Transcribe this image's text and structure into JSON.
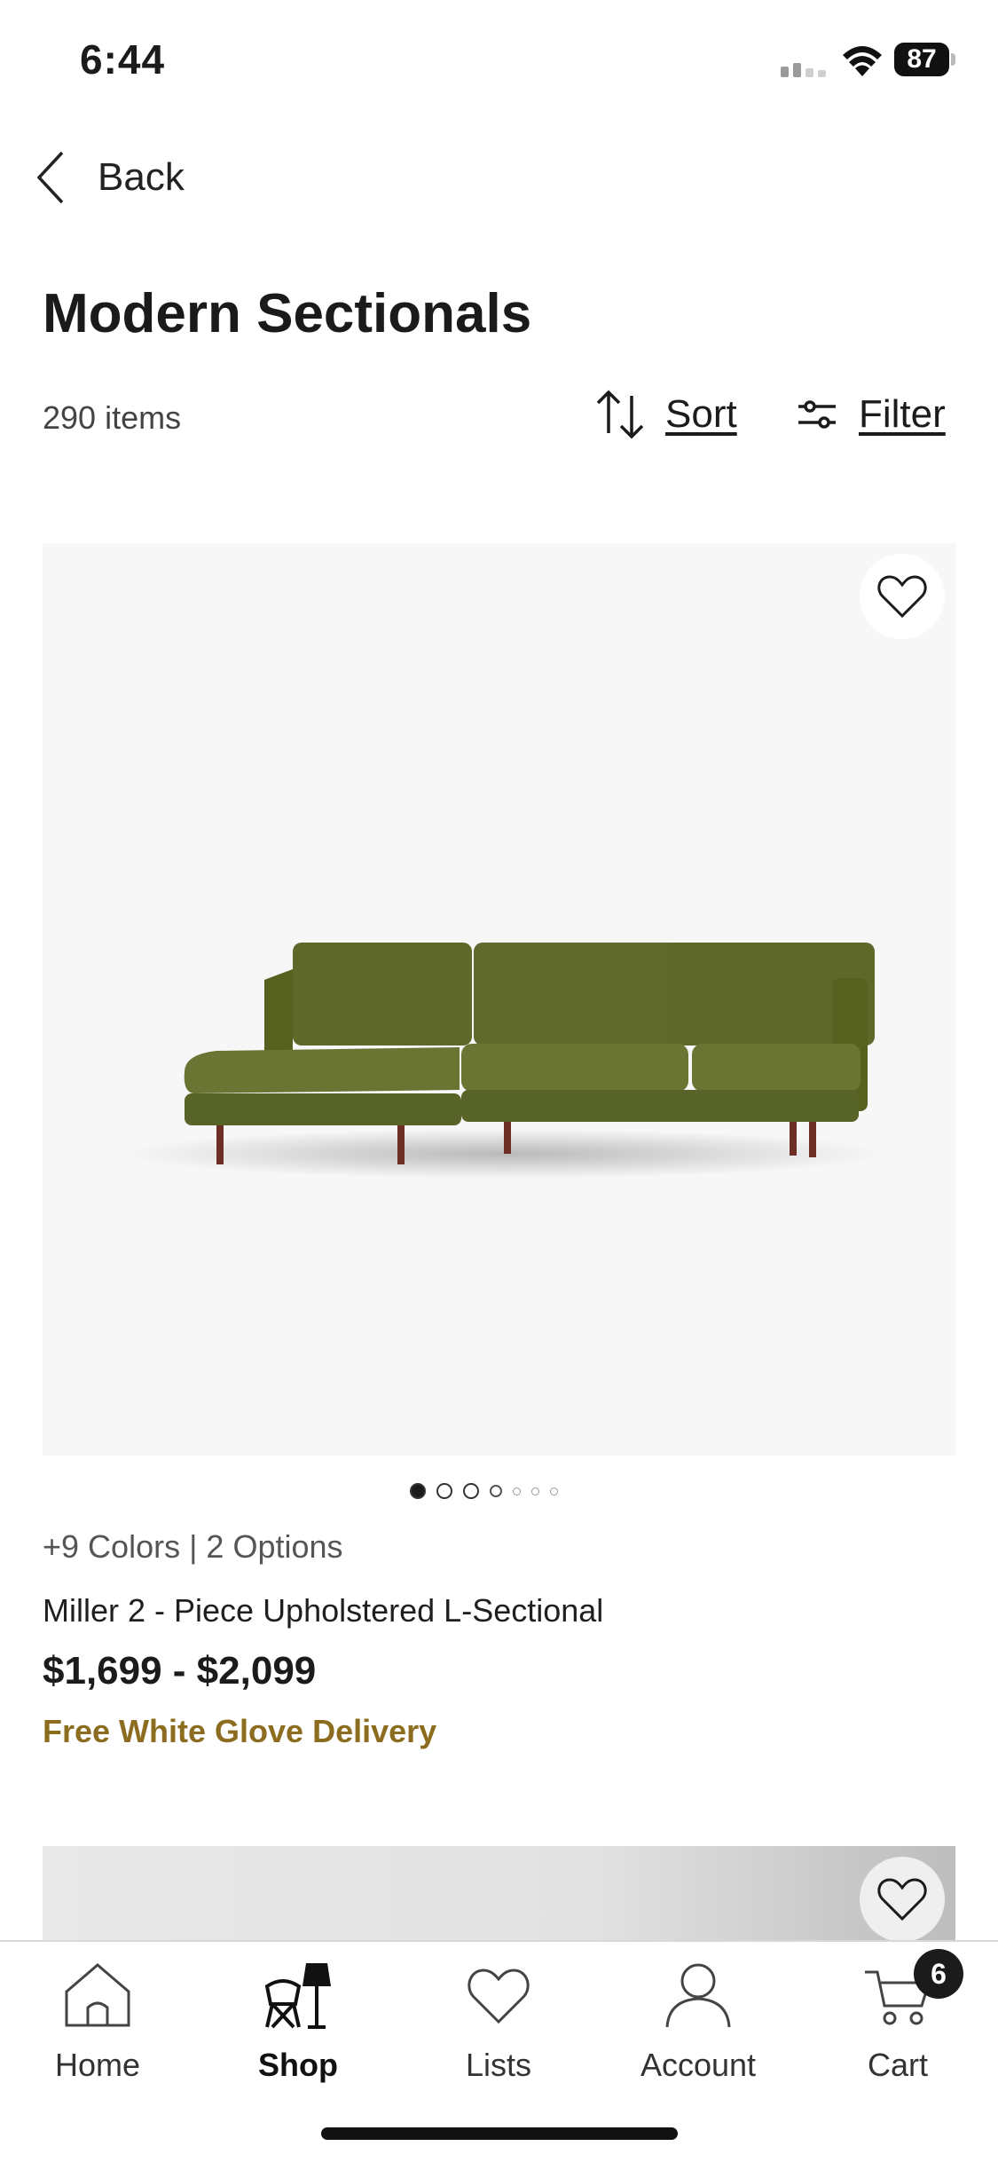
{
  "status_bar": {
    "time": "6:44",
    "battery": "87"
  },
  "nav": {
    "back_label": "Back"
  },
  "header": {
    "title": "Modern Sectionals"
  },
  "listing": {
    "item_count": "290 items",
    "sort_label": "Sort",
    "filter_label": "Filter"
  },
  "product": {
    "options": "+9 Colors | 2 Options",
    "name": "Miller 2 - Piece Upholstered L-Sectional",
    "price": "$1,699 - $2,099",
    "delivery": "Free White Glove Delivery",
    "image_count": 7,
    "active_image_index": 0,
    "upholstery_color": "#5f6a2c",
    "delivery_color": "#8c6d1f"
  },
  "tab_bar": {
    "items": [
      {
        "label": "Home",
        "icon": "home-icon"
      },
      {
        "label": "Shop",
        "icon": "chair-lamp-icon",
        "active": true
      },
      {
        "label": "Lists",
        "icon": "heart-icon"
      },
      {
        "label": "Account",
        "icon": "person-icon"
      },
      {
        "label": "Cart",
        "icon": "cart-icon"
      }
    ],
    "cart_count": "6"
  }
}
